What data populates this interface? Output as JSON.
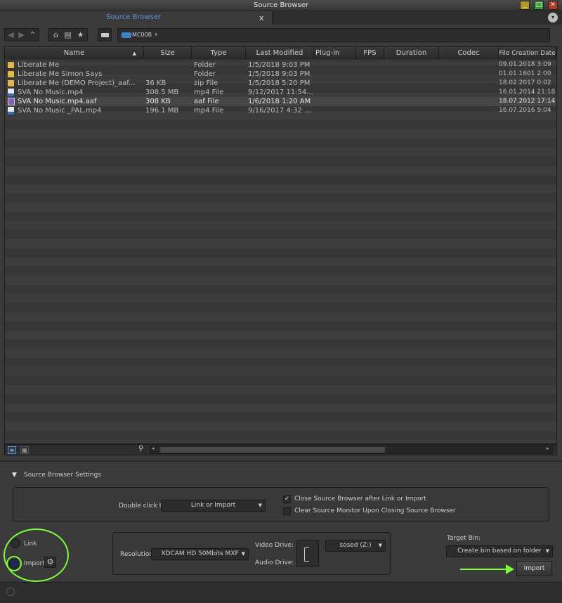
{
  "window": {
    "title": "Source Browser"
  },
  "tab": {
    "label": "Source Browser",
    "close": "x"
  },
  "path": {
    "location": "MC00B"
  },
  "columns": [
    "Name",
    "Size",
    "Type",
    "Last Modified",
    "Plug-in",
    "FPS",
    "Duration",
    "Codec",
    "File Creation Date"
  ],
  "files": [
    {
      "name": "Liberate Me",
      "size": "",
      "type": "Folder",
      "modified": "1/5/2018 9:03 PM",
      "created": "09.01.2018 3:09",
      "icon": "folder-icon"
    },
    {
      "name": "Liberate Me Simon Says",
      "size": "",
      "type": "Folder",
      "modified": "1/5/2018 9:03 PM",
      "created": "01.01.1601 2:00",
      "icon": "folder-icon"
    },
    {
      "name": "Liberate Me (DEMO Project)_aaf...",
      "size": "36 KB",
      "type": "zip File",
      "modified": "1/5/2018 5:20 PM",
      "created": "18.02.2017 0:02",
      "icon": "folder-icon"
    },
    {
      "name": "SVA No Music.mp4",
      "size": "308.5 MB",
      "type": "mp4 File",
      "modified": "9/12/2017 11:54...",
      "created": "16.01.2014 21:18",
      "icon": "video-file-icon"
    },
    {
      "name": "SVA No Music.mp4.aaf",
      "size": "308 KB",
      "type": "aaf File",
      "modified": "1/6/2018 1:20 AM",
      "created": "18.07.2012 17:14",
      "icon": "aaf-file-icon"
    },
    {
      "name": "SVA No Music _PAL.mp4",
      "size": "196.1 MB",
      "type": "mp4 File",
      "modified": "9/16/2017 4:32 ...",
      "created": "16.07.2016 9:04",
      "icon": "video-file-icon"
    }
  ],
  "settings": {
    "header": "Source Browser Settings",
    "double_click_label": "Double click to:",
    "double_click_value": "Link or Import",
    "close_after": "Close Source Browser after Link or Import",
    "clear_monitor": "Clear Source Monitor Upon Closing Source Browser"
  },
  "mode": {
    "link": "Link",
    "import": "Import"
  },
  "import_opts": {
    "resolution_label": "Resolution:",
    "resolution_value": "XDCAM HD 50Mbits  MXF",
    "video_drive": "Video Drive:",
    "audio_drive": "Audio Drive:",
    "drive_value": "sosed (Z:)"
  },
  "target": {
    "label": "Target Bin:",
    "value": "Create bin based on folder",
    "import_button": "Import"
  },
  "colors": {
    "accent_blue": "#5b93d6",
    "annotation_green": "#7cfc3c",
    "background": "#3a3a3a"
  }
}
